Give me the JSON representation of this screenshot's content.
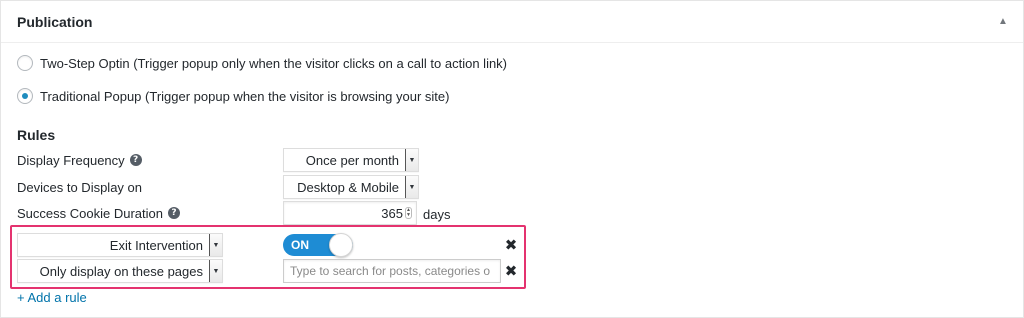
{
  "panel": {
    "title": "Publication",
    "collapse_glyph": "▲"
  },
  "publication_type": {
    "options": [
      {
        "label": "Two-Step Optin (Trigger popup only when the visitor clicks on a call to action link)",
        "checked": false
      },
      {
        "label": "Traditional Popup (Trigger popup when the visitor is browsing your site)",
        "checked": true
      }
    ]
  },
  "rules": {
    "title": "Rules",
    "display_frequency": {
      "label": "Display Frequency",
      "value": "Once per month",
      "help_glyph": "?"
    },
    "devices": {
      "label": "Devices to Display on",
      "value": "Desktop & Mobile"
    },
    "cookie_duration": {
      "label": "Success Cookie Duration",
      "value": "365",
      "unit": "days",
      "help_glyph": "?"
    },
    "custom_rules": [
      {
        "type": "Exit Intervention",
        "toggle_label": "ON",
        "toggle_on": true,
        "remove_glyph": "✖"
      },
      {
        "type": "Only display on these pages",
        "search_placeholder": "Type to search for posts, categories o",
        "remove_glyph": "✖"
      }
    ],
    "add_rule_label": "+ Add a rule"
  },
  "colors": {
    "accent_link": "#0073aa",
    "toggle_on": "#1e8cd4",
    "highlight_border": "#e4336f"
  },
  "icons": {
    "select_arrow": "▼",
    "spinner_up": "▲",
    "spinner_down": "▼"
  }
}
